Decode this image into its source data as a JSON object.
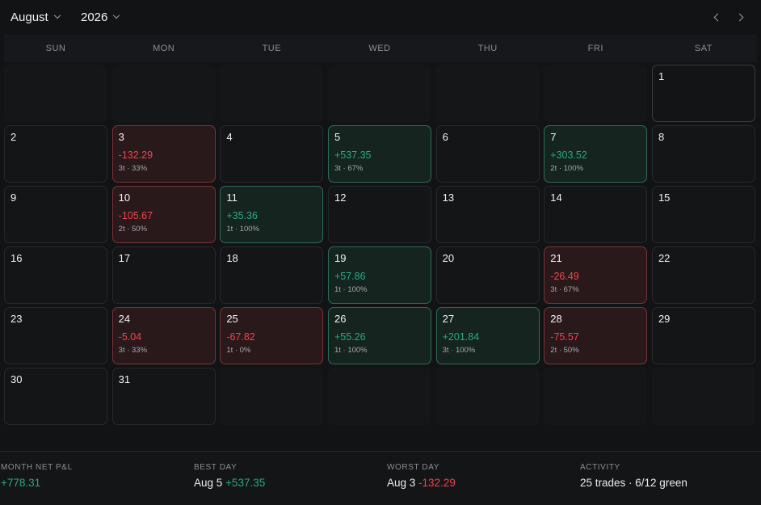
{
  "header": {
    "month": "August",
    "year": "2026"
  },
  "weekdays": [
    "SUN",
    "MON",
    "TUE",
    "WED",
    "THU",
    "FRI",
    "SAT"
  ],
  "calendar": {
    "leading_empty": 6,
    "days": [
      {
        "day": "1"
      },
      {
        "day": "2"
      },
      {
        "day": "3",
        "pnl": "-132.29",
        "meta": "3t · 33%",
        "result": "loss"
      },
      {
        "day": "4"
      },
      {
        "day": "5",
        "pnl": "+537.35",
        "meta": "3t · 67%",
        "result": "win"
      },
      {
        "day": "6"
      },
      {
        "day": "7",
        "pnl": "+303.52",
        "meta": "2t · 100%",
        "result": "win"
      },
      {
        "day": "8"
      },
      {
        "day": "9"
      },
      {
        "day": "10",
        "pnl": "-105.67",
        "meta": "2t · 50%",
        "result": "loss"
      },
      {
        "day": "11",
        "pnl": "+35.36",
        "meta": "1t · 100%",
        "result": "win"
      },
      {
        "day": "12"
      },
      {
        "day": "13"
      },
      {
        "day": "14"
      },
      {
        "day": "15"
      },
      {
        "day": "16"
      },
      {
        "day": "17"
      },
      {
        "day": "18"
      },
      {
        "day": "19",
        "pnl": "+57.86",
        "meta": "1t · 100%",
        "result": "win"
      },
      {
        "day": "20"
      },
      {
        "day": "21",
        "pnl": "-26.49",
        "meta": "3t · 67%",
        "result": "loss"
      },
      {
        "day": "22"
      },
      {
        "day": "23"
      },
      {
        "day": "24",
        "pnl": "-5.04",
        "meta": "3t · 33%",
        "result": "loss"
      },
      {
        "day": "25",
        "pnl": "-67.82",
        "meta": "1t · 0%",
        "result": "loss"
      },
      {
        "day": "26",
        "pnl": "+55.26",
        "meta": "1t · 100%",
        "result": "win"
      },
      {
        "day": "27",
        "pnl": "+201.84",
        "meta": "3t · 100%",
        "result": "win"
      },
      {
        "day": "28",
        "pnl": "-75.57",
        "meta": "2t · 50%",
        "result": "loss"
      },
      {
        "day": "29"
      },
      {
        "day": "30"
      },
      {
        "day": "31"
      }
    ],
    "trailing_empty": 5
  },
  "summary": {
    "net_label": "MONTH NET P&L",
    "net_value": "+778.31",
    "best_label": "BEST DAY",
    "best_date": "Aug 5",
    "best_value": "+537.35",
    "worst_label": "WORST DAY",
    "worst_date": "Aug 3",
    "worst_value": "-132.29",
    "activity_label": "ACTIVITY",
    "activity_value": "25 trades · 6/12 green"
  },
  "colors": {
    "background": "#121315",
    "positive": "#2aa884",
    "negative": "#f0444f"
  }
}
